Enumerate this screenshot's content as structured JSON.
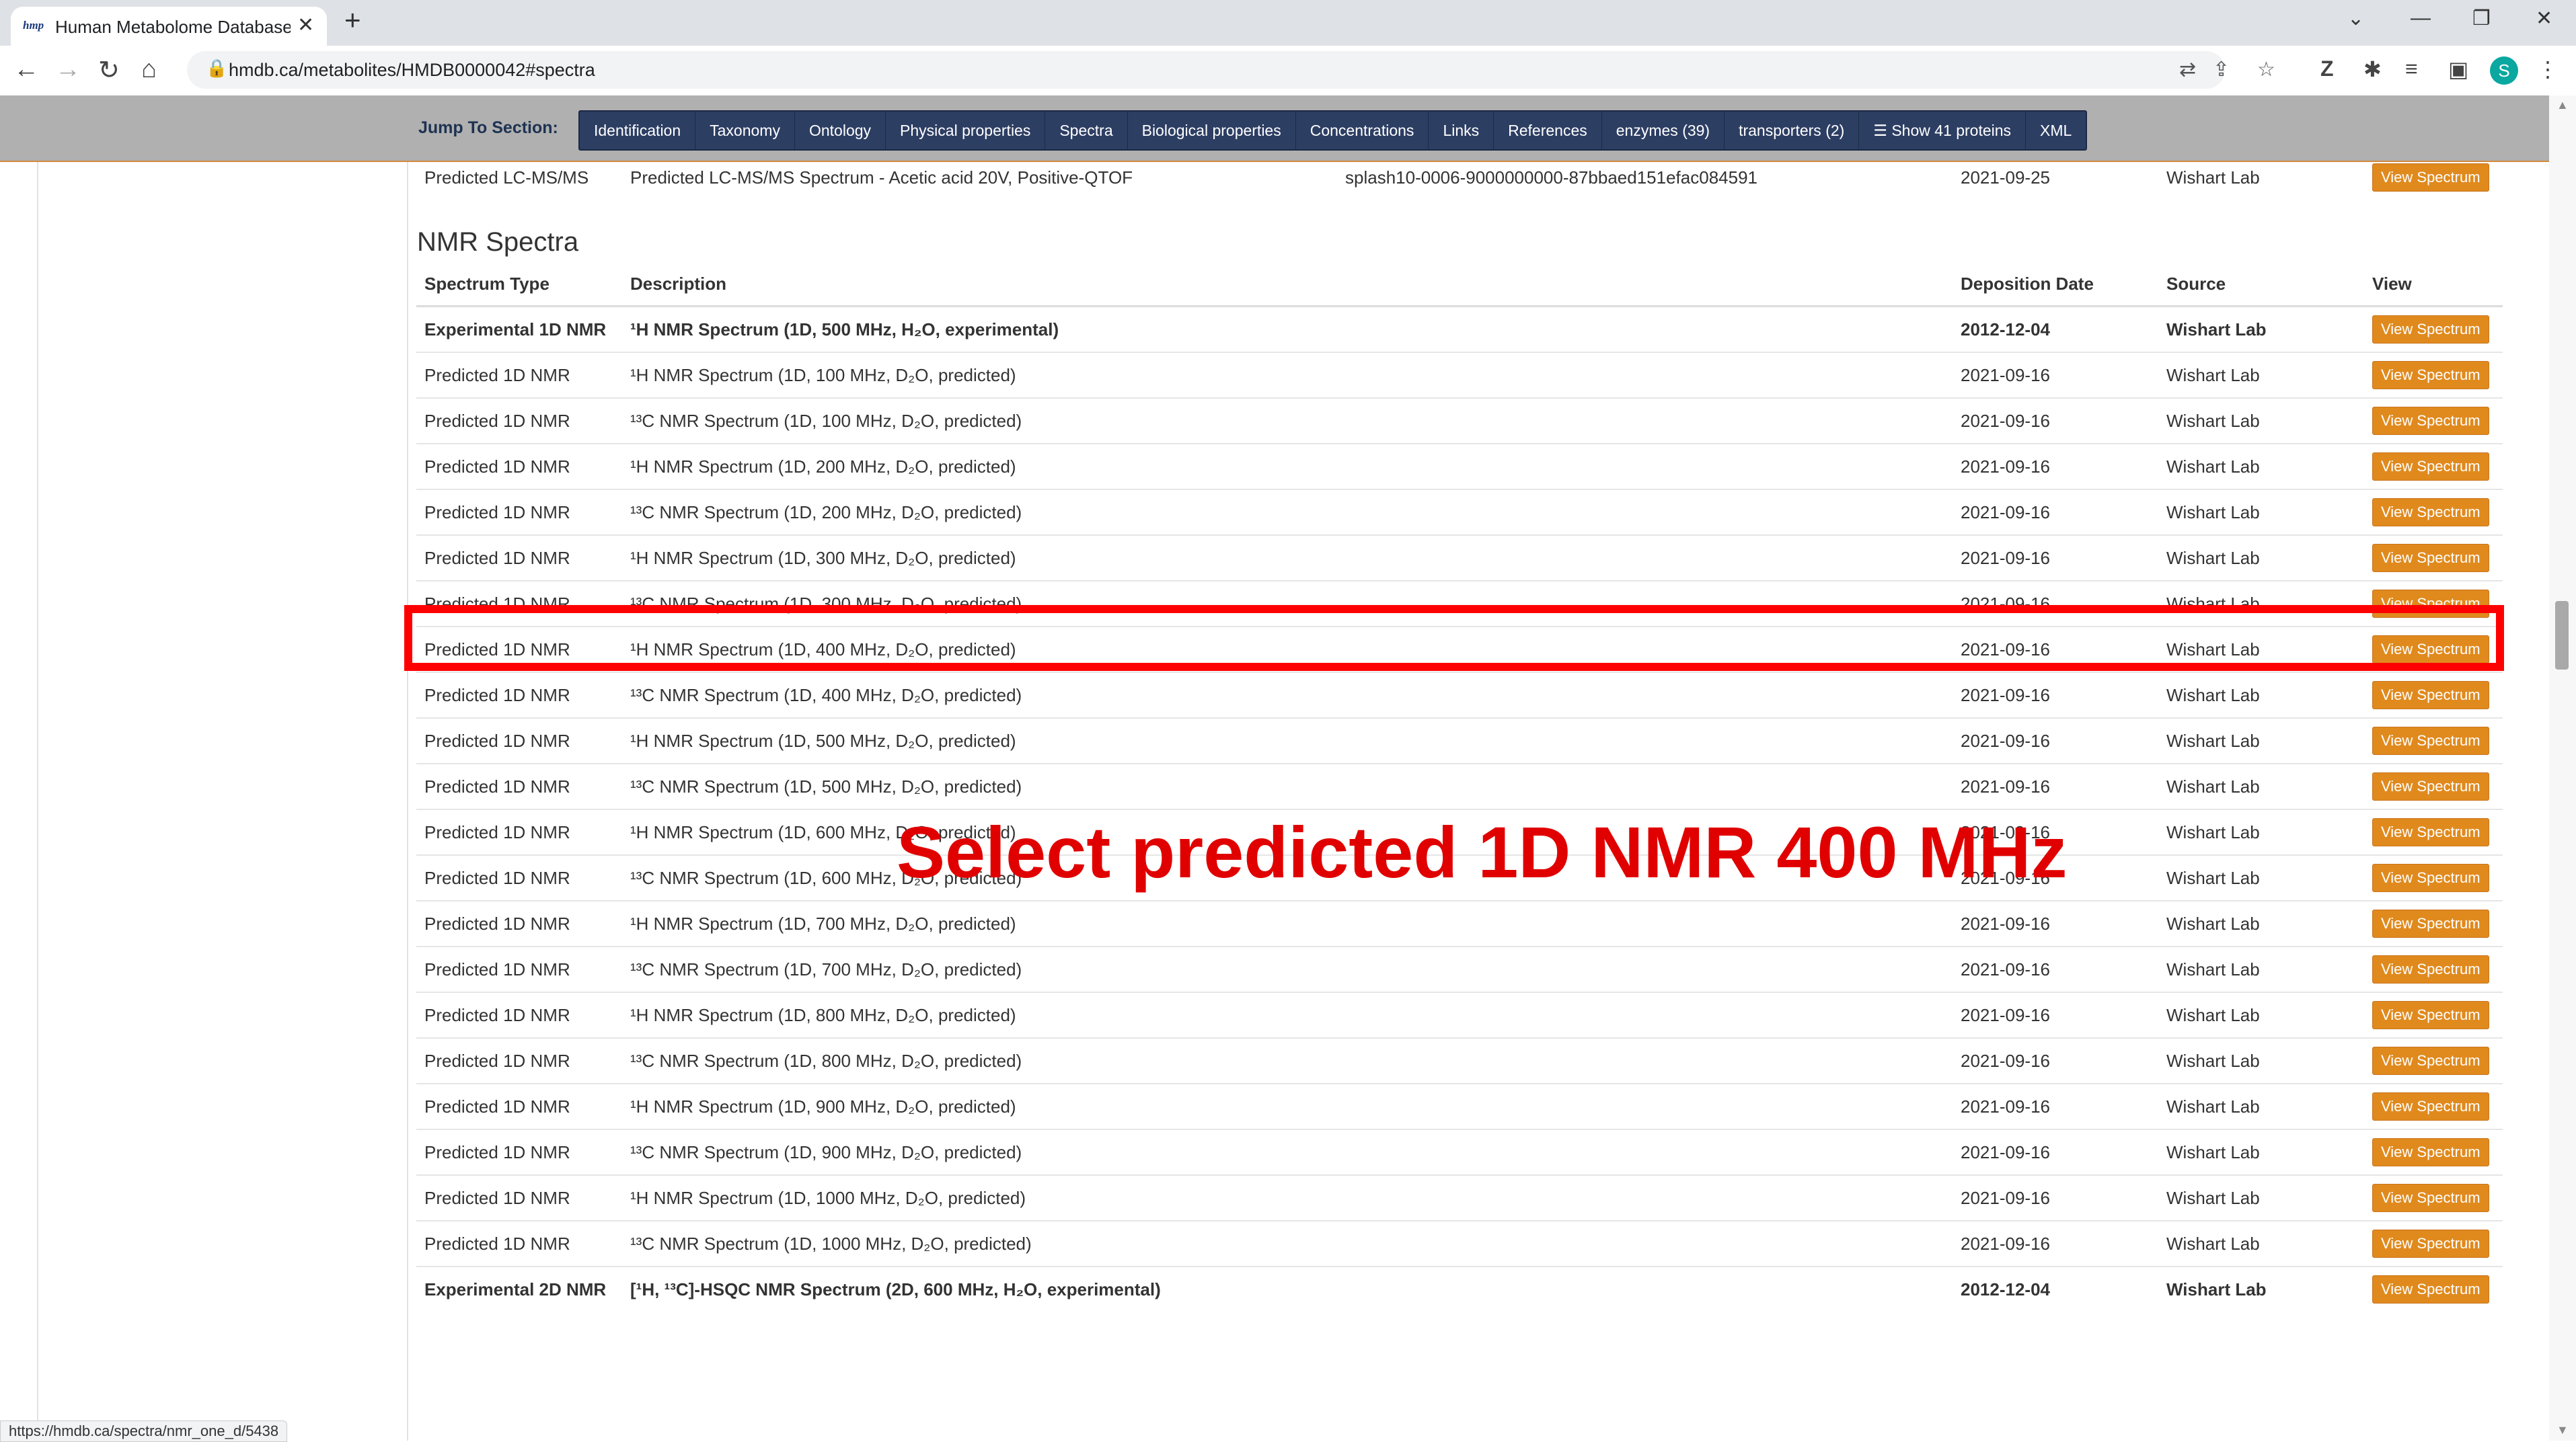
{
  "browser": {
    "tab_title": "Human Metabolome Database: S",
    "tab_favicon": "hmp",
    "url": "hmdb.ca/metabolites/HMDB0000042#spectra",
    "profile_initial": "S",
    "status_url": "https://hmdb.ca/spectra/nmr_one_d/5438"
  },
  "jump": {
    "label": "Jump To Section:",
    "items": [
      "Identification",
      "Taxonomy",
      "Ontology",
      "Physical properties",
      "Spectra",
      "Biological properties",
      "Concentrations",
      "Links",
      "References",
      "enzymes (39)",
      "transporters (2)",
      "☰ Show 41 proteins",
      "XML"
    ]
  },
  "top_row": {
    "type": "Predicted LC-MS/MS",
    "description": "Predicted LC-MS/MS Spectrum - Acetic acid 20V, Positive-QTOF",
    "splash": "splash10-0006-9000000000-87bbaed151efac084591",
    "date": "2021-09-25",
    "source": "Wishart Lab",
    "button": "View Spectrum"
  },
  "nmr": {
    "title": "NMR Spectra",
    "headers": {
      "type": "Spectrum Type",
      "description": "Description",
      "date": "Deposition Date",
      "source": "Source",
      "view": "View"
    },
    "rows": [
      {
        "type": "Experimental 1D NMR",
        "description": "¹H NMR Spectrum (1D, 500 MHz, H₂O, experimental)",
        "date": "2012-12-04",
        "source": "Wishart Lab",
        "button": "View Spectrum"
      },
      {
        "type": "Predicted 1D NMR",
        "description": "¹H NMR Spectrum (1D, 100 MHz, D₂O, predicted)",
        "date": "2021-09-16",
        "source": "Wishart Lab",
        "button": "View Spectrum"
      },
      {
        "type": "Predicted 1D NMR",
        "description": "¹³C NMR Spectrum (1D, 100 MHz, D₂O, predicted)",
        "date": "2021-09-16",
        "source": "Wishart Lab",
        "button": "View Spectrum"
      },
      {
        "type": "Predicted 1D NMR",
        "description": "¹H NMR Spectrum (1D, 200 MHz, D₂O, predicted)",
        "date": "2021-09-16",
        "source": "Wishart Lab",
        "button": "View Spectrum"
      },
      {
        "type": "Predicted 1D NMR",
        "description": "¹³C NMR Spectrum (1D, 200 MHz, D₂O, predicted)",
        "date": "2021-09-16",
        "source": "Wishart Lab",
        "button": "View Spectrum"
      },
      {
        "type": "Predicted 1D NMR",
        "description": "¹H NMR Spectrum (1D, 300 MHz, D₂O, predicted)",
        "date": "2021-09-16",
        "source": "Wishart Lab",
        "button": "View Spectrum"
      },
      {
        "type": "Predicted 1D NMR",
        "description": "¹³C NMR Spectrum (1D, 300 MHz, D₂O, predicted)",
        "date": "2021-09-16",
        "source": "Wishart Lab",
        "button": "View Spectrum"
      },
      {
        "type": "Predicted 1D NMR",
        "description": "¹H NMR Spectrum (1D, 400 MHz, D₂O, predicted)",
        "date": "2021-09-16",
        "source": "Wishart Lab",
        "button": "View Spectrum"
      },
      {
        "type": "Predicted 1D NMR",
        "description": "¹³C NMR Spectrum (1D, 400 MHz, D₂O, predicted)",
        "date": "2021-09-16",
        "source": "Wishart Lab",
        "button": "View Spectrum"
      },
      {
        "type": "Predicted 1D NMR",
        "description": "¹H NMR Spectrum (1D, 500 MHz, D₂O, predicted)",
        "date": "2021-09-16",
        "source": "Wishart Lab",
        "button": "View Spectrum"
      },
      {
        "type": "Predicted 1D NMR",
        "description": "¹³C NMR Spectrum (1D, 500 MHz, D₂O, predicted)",
        "date": "2021-09-16",
        "source": "Wishart Lab",
        "button": "View Spectrum"
      },
      {
        "type": "Predicted 1D NMR",
        "description": "¹H NMR Spectrum (1D, 600 MHz, D₂O, predicted)",
        "date": "2021-09-16",
        "source": "Wishart Lab",
        "button": "View Spectrum"
      },
      {
        "type": "Predicted 1D NMR",
        "description": "¹³C NMR Spectrum (1D, 600 MHz, D₂O, predicted)",
        "date": "2021-09-16",
        "source": "Wishart Lab",
        "button": "View Spectrum"
      },
      {
        "type": "Predicted 1D NMR",
        "description": "¹H NMR Spectrum (1D, 700 MHz, D₂O, predicted)",
        "date": "2021-09-16",
        "source": "Wishart Lab",
        "button": "View Spectrum"
      },
      {
        "type": "Predicted 1D NMR",
        "description": "¹³C NMR Spectrum (1D, 700 MHz, D₂O, predicted)",
        "date": "2021-09-16",
        "source": "Wishart Lab",
        "button": "View Spectrum"
      },
      {
        "type": "Predicted 1D NMR",
        "description": "¹H NMR Spectrum (1D, 800 MHz, D₂O, predicted)",
        "date": "2021-09-16",
        "source": "Wishart Lab",
        "button": "View Spectrum"
      },
      {
        "type": "Predicted 1D NMR",
        "description": "¹³C NMR Spectrum (1D, 800 MHz, D₂O, predicted)",
        "date": "2021-09-16",
        "source": "Wishart Lab",
        "button": "View Spectrum"
      },
      {
        "type": "Predicted 1D NMR",
        "description": "¹H NMR Spectrum (1D, 900 MHz, D₂O, predicted)",
        "date": "2021-09-16",
        "source": "Wishart Lab",
        "button": "View Spectrum"
      },
      {
        "type": "Predicted 1D NMR",
        "description": "¹³C NMR Spectrum (1D, 900 MHz, D₂O, predicted)",
        "date": "2021-09-16",
        "source": "Wishart Lab",
        "button": "View Spectrum"
      },
      {
        "type": "Predicted 1D NMR",
        "description": "¹H NMR Spectrum (1D, 1000 MHz, D₂O, predicted)",
        "date": "2021-09-16",
        "source": "Wishart Lab",
        "button": "View Spectrum"
      },
      {
        "type": "Predicted 1D NMR",
        "description": "¹³C NMR Spectrum (1D, 1000 MHz, D₂O, predicted)",
        "date": "2021-09-16",
        "source": "Wishart Lab",
        "button": "View Spectrum"
      },
      {
        "type": "Experimental 2D NMR",
        "description": "[¹H, ¹³C]-HSQC NMR Spectrum (2D, 600 MHz, H₂O, experimental)",
        "date": "2012-12-04",
        "source": "Wishart Lab",
        "button": "View Spectrum"
      }
    ]
  },
  "annotation": {
    "text": "Select  predicted 1D NMR 400 MHz",
    "color": "#e00000"
  },
  "colors": {
    "button": "#e08a1e",
    "jump_nav": "#2d3e63",
    "highlight": "#ff0000"
  }
}
